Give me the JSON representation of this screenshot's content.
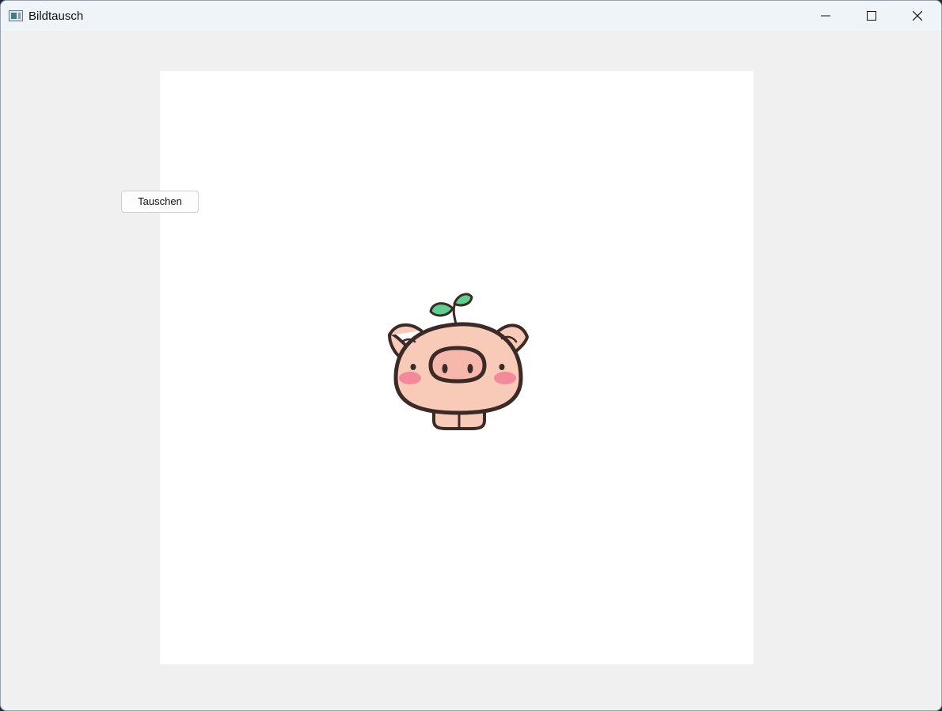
{
  "window": {
    "title": "Bildtausch",
    "controls": {
      "minimize": "minimize",
      "maximize": "maximize",
      "close": "close"
    }
  },
  "toolbar": {
    "swap_label": "Tauschen"
  },
  "image_panel": {
    "content": "pig-with-sprout-illustration"
  },
  "colors": {
    "titlebar": "#eff4f9",
    "window_bg": "#f0f0f0",
    "panel_bg": "#ffffff",
    "pig_skin": "#f8cbb8",
    "pig_outline": "#3b2a26",
    "cheeks": "#f4899b",
    "sprout": "#5fcf8e"
  }
}
